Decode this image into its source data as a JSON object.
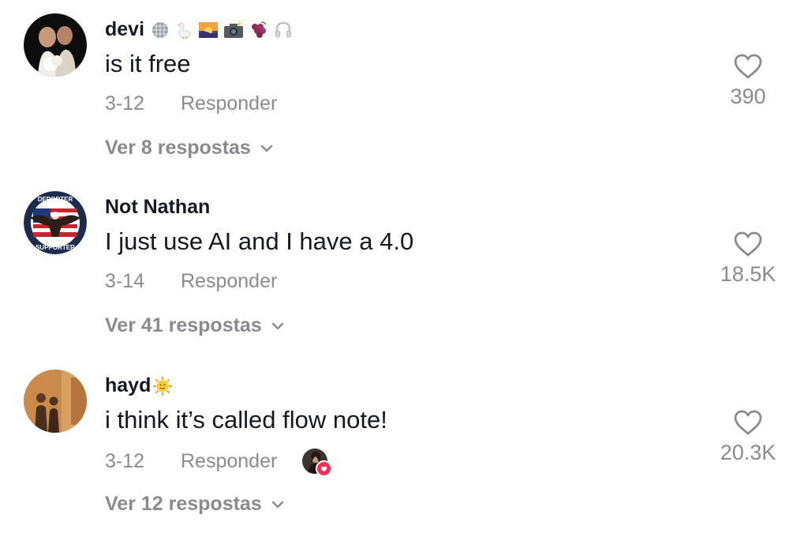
{
  "comments": [
    {
      "username": "devi",
      "username_emojis": [
        "mirror-ball-icon",
        "goose-icon",
        "sunset-icon",
        "camera-flash-icon",
        "grapes-icon",
        "headphones-icon"
      ],
      "text": "is it free",
      "date": "3-12",
      "reply_label": "Responder",
      "view_replies": "Ver 8 respostas",
      "likes": "390"
    },
    {
      "username": "Not Nathan",
      "username_emojis": [],
      "text": "I just use AI and I have a 4.0",
      "date": "3-14",
      "reply_label": "Responder",
      "view_replies": "Ver 41 respostas",
      "likes": "18.5K",
      "avatar_badge_top": "DEPORTER",
      "avatar_badge_bottom": "SUPPORTER"
    },
    {
      "username": "hayd",
      "username_emojis": [
        "sun-face-icon"
      ],
      "text": "i think it’s called flow note!",
      "date": "3-12",
      "reply_label": "Responder",
      "view_replies": "Ver 12 respostas",
      "likes": "20.3K",
      "liked_by_creator": true
    }
  ],
  "colors": {
    "primary_text": "#161823",
    "secondary_text": "#8a8b91",
    "like_badge": "#fe2c55"
  }
}
